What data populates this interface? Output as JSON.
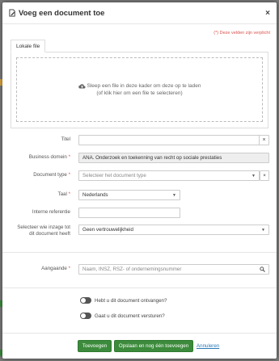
{
  "modal": {
    "title": "Voeg een document toe",
    "close": "×",
    "required_note": "(*) Deze velden zijn verplicht"
  },
  "upload": {
    "tab_label": "Lokale file",
    "drop_line1": "Sleep een file in deze kader om deze op te laden",
    "drop_line2": "(of klik hier om een file te selecteren)"
  },
  "form": {
    "titel": {
      "label": "Titel",
      "value": ""
    },
    "business_domein": {
      "label": "Business domein",
      "value": "ANA. Onderzoek en toekenning van recht op sociale prestaties"
    },
    "document_type": {
      "label": "Document type",
      "placeholder": "Selecteer het document type"
    },
    "taal": {
      "label": "Taal",
      "value": "Nederlands"
    },
    "interne_referentie": {
      "label": "Interne referentie",
      "value": ""
    },
    "inzage": {
      "label_line1": "Selecteer wie inzage tot",
      "label_line2": "dit document heeft",
      "value": "Geen vertrouwelijkheid"
    },
    "aangaande": {
      "label": "Aangaande",
      "placeholder": "Naam, INSZ, RSZ- of ondernemingsnummer"
    },
    "required_marker": "*"
  },
  "toggles": {
    "ontvangen": "Hebt u dit document ontvangen?",
    "versturen": "Gaat u dit document versturen?"
  },
  "footer": {
    "add": "Toevoegen",
    "save_add_another": "Opslaan en nog één toevoegen",
    "cancel": "Annuleren"
  }
}
